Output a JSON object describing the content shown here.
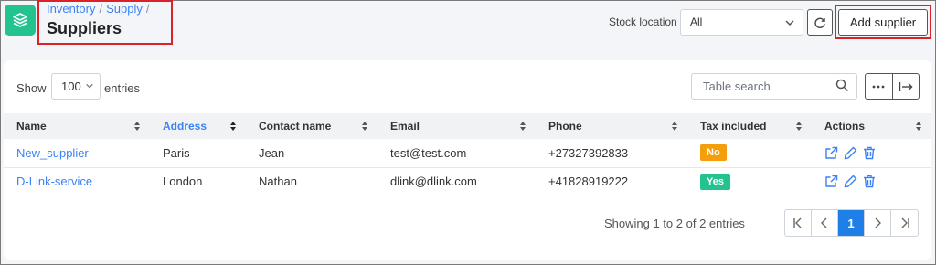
{
  "breadcrumb": [
    "Inventory",
    "Supply"
  ],
  "page_title": "Suppliers",
  "stock_location": {
    "label": "Stock location",
    "selected": "All"
  },
  "add_button": "Add supplier",
  "table_controls": {
    "show_label": "Show",
    "entries_value": "100",
    "entries_label": "entries",
    "search_placeholder": "Table search"
  },
  "columns": [
    "Name",
    "Address",
    "Contact name",
    "Email",
    "Phone",
    "Tax included",
    "Actions"
  ],
  "rows": [
    {
      "name": "New_supplier",
      "address": "Paris",
      "contact": "Jean",
      "email": "test@test.com",
      "phone": "+27327392833",
      "tax": "No"
    },
    {
      "name": "D-Link-service",
      "address": "London",
      "contact": "Nathan",
      "email": "dlink@dlink.com",
      "phone": "+41828919222",
      "tax": "Yes"
    }
  ],
  "footer": {
    "showing": "Showing 1 to 2 of 2 entries",
    "current_page": "1"
  },
  "colors": {
    "accent": "#3b82f6",
    "brand": "#22c38e",
    "badge_no": "#f59e0b",
    "badge_yes": "#22c38e",
    "highlight": "#d9222a"
  }
}
